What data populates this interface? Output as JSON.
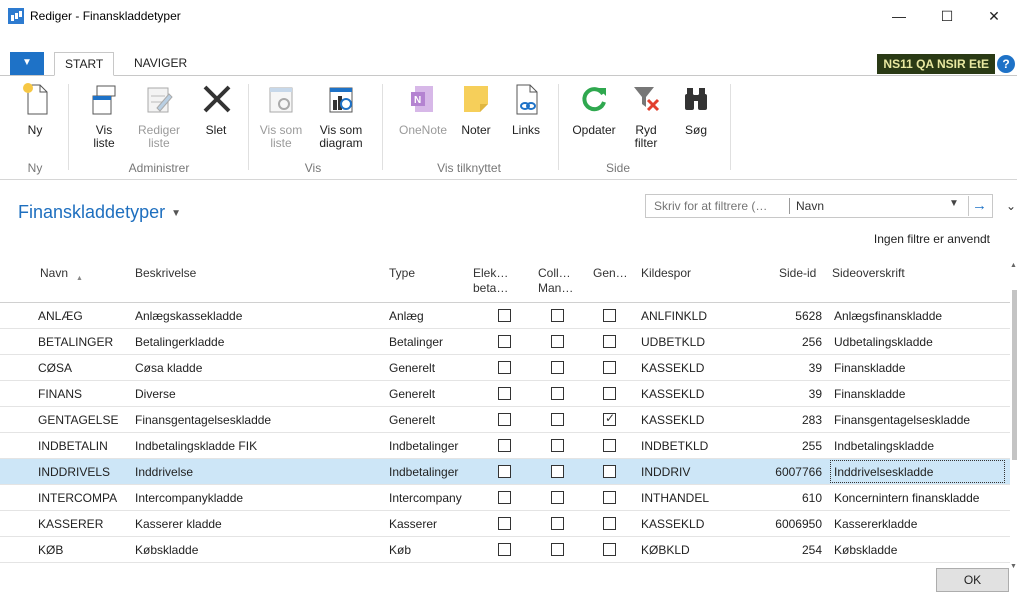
{
  "window": {
    "title": "Rediger - Finanskladdetyper",
    "minimize": "—",
    "maximize": "☐",
    "close": "✕"
  },
  "tabs": {
    "file": "▼",
    "start": "START",
    "naviger": "NAVIGER",
    "company": "NS11 QA NSIR EtE",
    "help": "?"
  },
  "ribbon": {
    "ny": "Ny",
    "vis_liste": [
      "Vis",
      "liste"
    ],
    "rediger_liste": [
      "Rediger",
      "liste"
    ],
    "slet": "Slet",
    "vis_som_liste": [
      "Vis som",
      "liste"
    ],
    "vis_som_diagram": [
      "Vis som",
      "diagram"
    ],
    "onenote": "OneNote",
    "noter": "Noter",
    "links": "Links",
    "opdater": "Opdater",
    "ryd_filter": [
      "Ryd",
      "filter"
    ],
    "soeg": "Søg",
    "groups": {
      "ny": "Ny",
      "administrer": "Administrer",
      "vis": "Vis",
      "vis_tilknyttet": "Vis tilknyttet",
      "side": "Side"
    }
  },
  "page": {
    "title": "Finanskladdetyper",
    "filter_placeholder": "Skriv for at filtrere (…",
    "filter_field": "Navn",
    "no_filters": "Ingen filtre er anvendt"
  },
  "columns": {
    "navn": "Navn",
    "beskrivelse": "Beskrivelse",
    "type": "Type",
    "elek": [
      "Elek…",
      "beta…"
    ],
    "coll": [
      "Coll…",
      "Man…"
    ],
    "gen": "Gen…",
    "kildespor": "Kildespor",
    "sideid": "Side-id",
    "sideoverskrift": "Sideoverskrift"
  },
  "rows": [
    {
      "navn": "ANLÆG",
      "beskrivelse": "Anlægskassekladde",
      "type": "Anlæg",
      "elek": false,
      "coll": false,
      "gen": false,
      "kildespor": "ANLFINKLD",
      "sideid": "5628",
      "sideoverskrift": "Anlægsfinanskladde"
    },
    {
      "navn": "BETALINGER",
      "beskrivelse": "Betalingerkladde",
      "type": "Betalinger",
      "elek": false,
      "coll": false,
      "gen": false,
      "kildespor": "UDBETKLD",
      "sideid": "256",
      "sideoverskrift": "Udbetalingskladde"
    },
    {
      "navn": "CØSA",
      "beskrivelse": "Cøsa kladde",
      "type": "Generelt",
      "elek": false,
      "coll": false,
      "gen": false,
      "kildespor": "KASSEKLD",
      "sideid": "39",
      "sideoverskrift": "Finanskladde"
    },
    {
      "navn": "FINANS",
      "beskrivelse": "Diverse",
      "type": "Generelt",
      "elek": false,
      "coll": false,
      "gen": false,
      "kildespor": "KASSEKLD",
      "sideid": "39",
      "sideoverskrift": "Finanskladde"
    },
    {
      "navn": "GENTAGELSE",
      "beskrivelse": "Finansgentagelseskladde",
      "type": "Generelt",
      "elek": false,
      "coll": false,
      "gen": true,
      "kildespor": "KASSEKLD",
      "sideid": "283",
      "sideoverskrift": "Finansgentagelseskladde"
    },
    {
      "navn": "INDBETALIN",
      "beskrivelse": "Indbetalingskladde FIK",
      "type": "Indbetalinger",
      "elek": false,
      "coll": false,
      "gen": false,
      "kildespor": "INDBETKLD",
      "sideid": "255",
      "sideoverskrift": "Indbetalingskladde"
    },
    {
      "navn": "INDDRIVELS",
      "beskrivelse": "Inddrivelse",
      "type": "Indbetalinger",
      "elek": false,
      "coll": false,
      "gen": false,
      "kildespor": "INDDRIV",
      "sideid": "6007766",
      "sideoverskrift": "Inddrivelseskladde"
    },
    {
      "navn": "INTERCOMPA",
      "beskrivelse": "Intercompanykladde",
      "type": "Intercompany",
      "elek": false,
      "coll": false,
      "gen": false,
      "kildespor": "INTHANDEL",
      "sideid": "610",
      "sideoverskrift": "Koncernintern finanskladde"
    },
    {
      "navn": "KASSERER",
      "beskrivelse": "Kasserer kladde",
      "type": "Kasserer",
      "elek": false,
      "coll": false,
      "gen": false,
      "kildespor": "KASSEKLD",
      "sideid": "6006950",
      "sideoverskrift": "Kassererkladde"
    },
    {
      "navn": "KØB",
      "beskrivelse": "Købskladde",
      "type": "Køb",
      "elek": false,
      "coll": false,
      "gen": false,
      "kildespor": "KØBKLD",
      "sideid": "254",
      "sideoverskrift": "Købskladde"
    }
  ],
  "selected_row": 6,
  "footer": {
    "ok": "OK"
  }
}
